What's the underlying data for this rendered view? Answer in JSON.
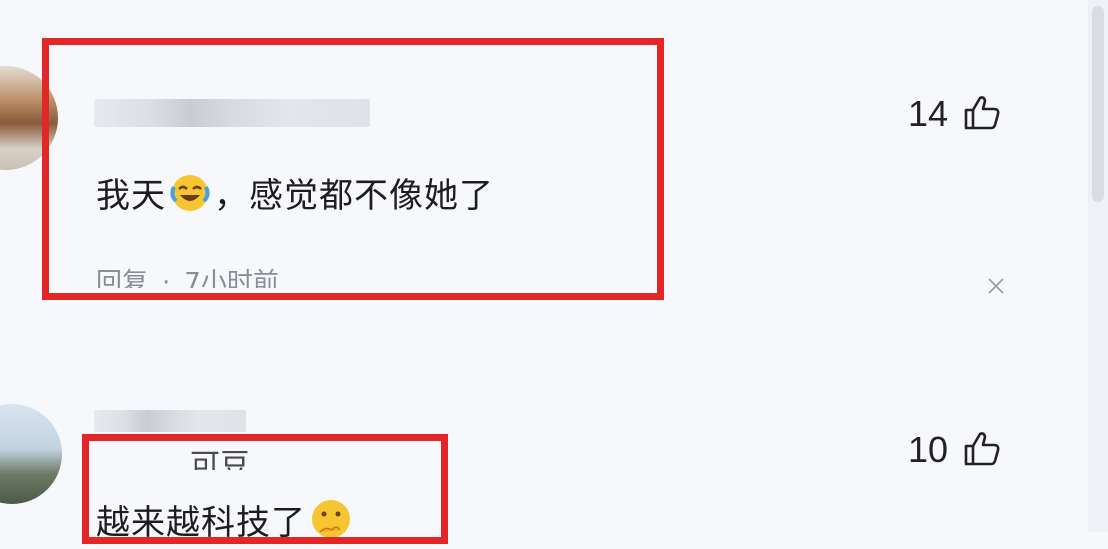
{
  "comments": [
    {
      "text_before": "我天",
      "emoji": "laughing-crying-emoji",
      "text_after": "，感觉都不像她了",
      "likes": "14",
      "meta": {
        "reply_label": "回复",
        "separator": "·",
        "time": "7小时前"
      }
    },
    {
      "partial_text": "可豆",
      "text_before": "越来越科技了",
      "emoji": "thinking-emoji",
      "likes": "10"
    }
  ],
  "colors": {
    "highlight": "#e32626",
    "background": "#f6f8fb",
    "meta": "#8a8d93"
  }
}
